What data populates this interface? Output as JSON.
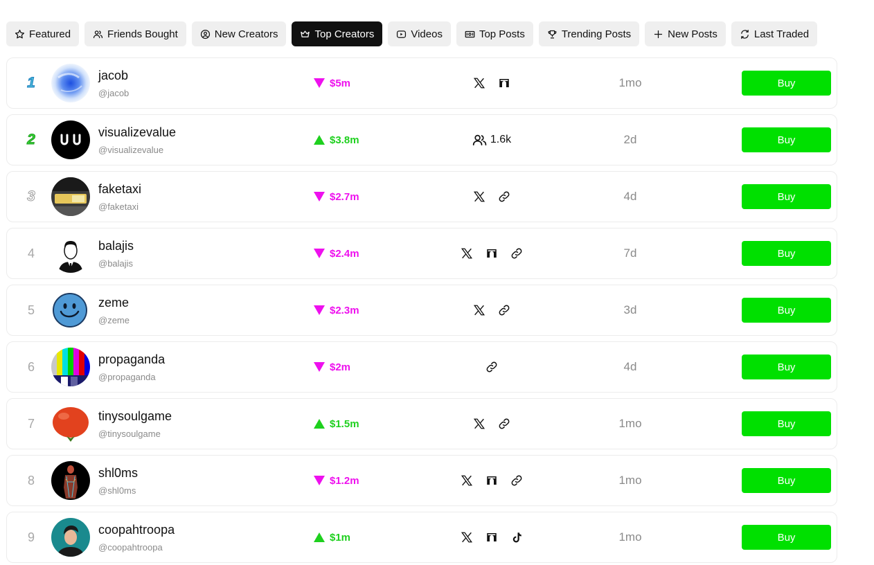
{
  "tabs": [
    {
      "label": "Featured",
      "icon": "star-icon",
      "active": false
    },
    {
      "label": "Friends Bought",
      "icon": "users-icon",
      "active": false
    },
    {
      "label": "New Creators",
      "icon": "user-circle-icon",
      "active": false
    },
    {
      "label": "Top Creators",
      "icon": "crown-icon",
      "active": true
    },
    {
      "label": "Videos",
      "icon": "video-icon",
      "active": false
    },
    {
      "label": "Top Posts",
      "icon": "banknote-icon",
      "active": false
    },
    {
      "label": "Trending Posts",
      "icon": "trophy-icon",
      "active": false
    },
    {
      "label": "New Posts",
      "icon": "plus-icon",
      "active": false
    },
    {
      "label": "Last Traded",
      "icon": "refresh-icon",
      "active": false
    }
  ],
  "colors": {
    "price_down": "#ee10ee",
    "price_up": "#1ed01e",
    "buy_button": "#00e000",
    "active_tab": "#111111"
  },
  "creators": [
    {
      "rank": "1",
      "name": "jacob",
      "handle": "@jacob",
      "price": "$5m",
      "trend": "down",
      "socials": [
        "x-icon",
        "arch-icon"
      ],
      "friends": "",
      "age": "1mo",
      "buy_label": "Buy"
    },
    {
      "rank": "2",
      "name": "visualizevalue",
      "handle": "@visualizevalue",
      "price": "$3.8m",
      "trend": "up",
      "socials": [],
      "friends": "1.6k",
      "age": "2d",
      "buy_label": "Buy"
    },
    {
      "rank": "3",
      "name": "faketaxi",
      "handle": "@faketaxi",
      "price": "$2.7m",
      "trend": "down",
      "socials": [
        "x-icon",
        "link-icon"
      ],
      "friends": "",
      "age": "4d",
      "buy_label": "Buy"
    },
    {
      "rank": "4",
      "name": "balajis",
      "handle": "@balajis",
      "price": "$2.4m",
      "trend": "down",
      "socials": [
        "x-icon",
        "arch-icon",
        "link-icon"
      ],
      "friends": "",
      "age": "7d",
      "buy_label": "Buy"
    },
    {
      "rank": "5",
      "name": "zeme",
      "handle": "@zeme",
      "price": "$2.3m",
      "trend": "down",
      "socials": [
        "x-icon",
        "link-icon"
      ],
      "friends": "",
      "age": "3d",
      "buy_label": "Buy"
    },
    {
      "rank": "6",
      "name": "propaganda",
      "handle": "@propaganda",
      "price": "$2m",
      "trend": "down",
      "socials": [
        "link-icon"
      ],
      "friends": "",
      "age": "4d",
      "buy_label": "Buy"
    },
    {
      "rank": "7",
      "name": "tinysoulgame",
      "handle": "@tinysoulgame",
      "price": "$1.5m",
      "trend": "up",
      "socials": [
        "x-icon",
        "link-icon"
      ],
      "friends": "",
      "age": "1mo",
      "buy_label": "Buy"
    },
    {
      "rank": "8",
      "name": "shl0ms",
      "handle": "@shl0ms",
      "price": "$1.2m",
      "trend": "down",
      "socials": [
        "x-icon",
        "arch-icon",
        "link-icon"
      ],
      "friends": "",
      "age": "1mo",
      "buy_label": "Buy"
    },
    {
      "rank": "9",
      "name": "coopahtroopa",
      "handle": "@coopahtroopa",
      "price": "$1m",
      "trend": "up",
      "socials": [
        "x-icon",
        "arch-icon",
        "tiktok-icon"
      ],
      "friends": "",
      "age": "1mo",
      "buy_label": "Buy"
    }
  ]
}
